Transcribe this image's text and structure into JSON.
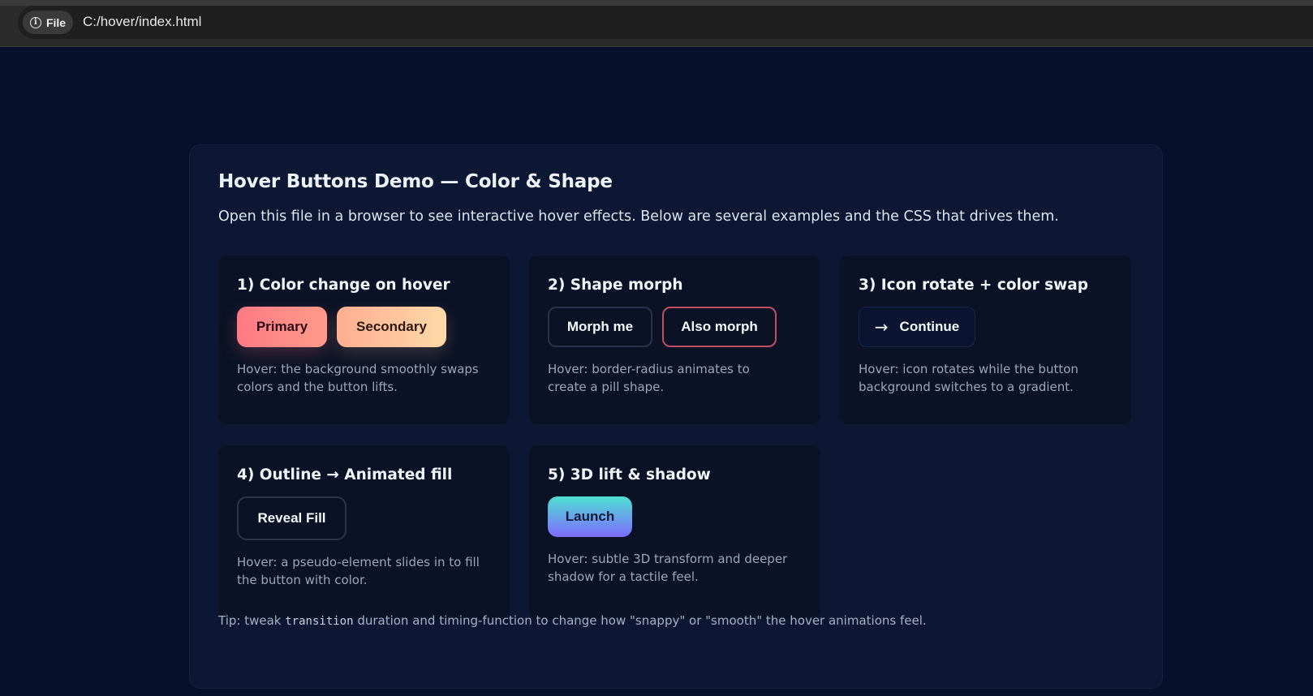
{
  "browser": {
    "chip_label": "File",
    "url": "C:/hover/index.html"
  },
  "page": {
    "title": "Hover Buttons Demo — Color & Shape",
    "intro": "Open this file in a browser to see interactive hover effects. Below are several examples and the CSS that drives them.",
    "cards": [
      {
        "heading": "1) Color change on hover",
        "buttons": [
          "Primary",
          "Secondary"
        ],
        "desc": "Hover: the background smoothly swaps colors and the button lifts."
      },
      {
        "heading": "2) Shape morph",
        "buttons": [
          "Morph me",
          "Also morph"
        ],
        "desc": "Hover: border-radius animates to create a pill shape."
      },
      {
        "heading": "3) Icon rotate + color swap",
        "buttons": [
          "Continue"
        ],
        "icon": "arrow-right-icon",
        "desc": "Hover: icon rotates while the button background switches to a gradient."
      },
      {
        "heading": "4) Outline → Animated fill",
        "buttons": [
          "Reveal Fill"
        ],
        "desc": "Hover: a pseudo-element slides in to fill the button with color."
      },
      {
        "heading": "5) 3D lift & shadow",
        "buttons": [
          "Launch"
        ],
        "desc": "Hover: subtle 3D transform and deeper shadow for a tactile feel."
      }
    ],
    "tip": {
      "prefix": "Tip: tweak ",
      "code": "transition",
      "suffix": " duration and timing-function to change how \"snappy\" or \"smooth\" the hover animations feel."
    }
  },
  "colors": {
    "page_bg": "#07102a",
    "panel_bg": "#0c1733",
    "card_bg": "#0b1226",
    "primary_gradient": [
      "#ff7a84",
      "#ff9b8a"
    ],
    "secondary_gradient": [
      "#ffae91",
      "#ffd9a8"
    ],
    "also_morph_border": "#c14f62",
    "launch_gradient": [
      "#4fe0d2",
      "#7e6bff"
    ]
  }
}
